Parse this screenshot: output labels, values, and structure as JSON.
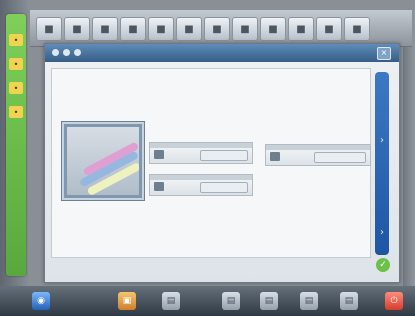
{
  "dialog": {
    "title": "",
    "footer_label": "",
    "cards": [
      {
        "label": "",
        "button": ""
      },
      {
        "label": "",
        "button": ""
      },
      {
        "label": "",
        "button": ""
      }
    ]
  },
  "icons": {
    "left_rail": [
      "pin-icon",
      "star-icon",
      "cross-icon",
      "dot-icon"
    ],
    "top_toolbar": [
      "tool-icon",
      "tool-icon",
      "tool-icon",
      "tool-icon",
      "tool-icon",
      "tool-icon",
      "tool-icon",
      "tool-icon",
      "tool-icon",
      "tool-icon",
      "tool-icon",
      "tool-icon"
    ],
    "dock": [
      "globe-icon",
      "folder-icon",
      "folder-icon",
      "folder-icon",
      "document-icon",
      "document-icon",
      "document-icon",
      "document-icon",
      "power-icon"
    ]
  }
}
